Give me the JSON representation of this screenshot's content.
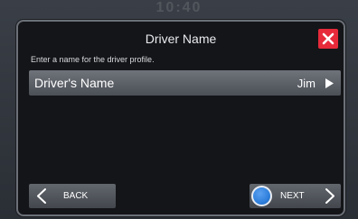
{
  "status_bar": {
    "time": "10:40"
  },
  "dialog": {
    "title": "Driver Name",
    "instruction": "Enter a name for the driver profile.",
    "close_icon": "close-icon",
    "row": {
      "label": "Driver's Name",
      "value": "Jim",
      "arrow_icon": "play-arrow-icon"
    }
  },
  "footer": {
    "back_label": "BACK",
    "back_icon": "chevron-left-icon",
    "next_label": "NEXT",
    "next_icon": "chevron-right-icon",
    "next_indicator": "radio-dot-icon"
  },
  "colors": {
    "close_red": "#e62a3a",
    "indicator_blue": "#2f7fdc",
    "panel_bg": "#141518",
    "button_gray": "#55595f"
  }
}
